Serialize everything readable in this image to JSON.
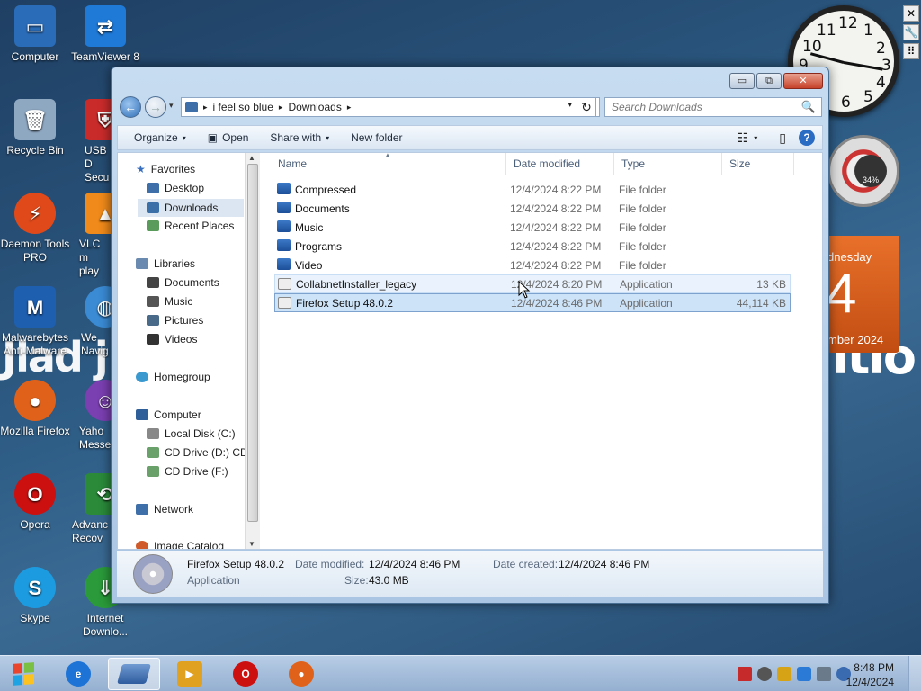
{
  "desktop": {
    "watermark_left": "Jlad j",
    "watermark_right": "itio",
    "icons": [
      {
        "label": "Computer",
        "color": "#2b6cb8"
      },
      {
        "label": "TeamViewer 8",
        "color": "#1f79d6"
      },
      {
        "label": "Recycle Bin",
        "color": "#8fa8c2"
      },
      {
        "label": "USB D Secu",
        "color": "#c92b2b"
      },
      {
        "label": "Daemon Tools PRO",
        "color": "#e04a1a"
      },
      {
        "label": "VLC m play",
        "color": "#f08a1a"
      },
      {
        "label": "Malwarebytes Anti-Malware",
        "color": "#1e5fb0"
      },
      {
        "label": "We Navig",
        "color": "#3a8bd4"
      },
      {
        "label": "Mozilla Firefox",
        "color": "#e0621a"
      },
      {
        "label": "Yaho Messe",
        "color": "#7a3fb0"
      },
      {
        "label": "Opera",
        "color": "#cc1010"
      },
      {
        "label": "Advanc Recov",
        "color": "#2a8a3a"
      },
      {
        "label": "Skype",
        "color": "#1d9be0"
      },
      {
        "label": "Internet Downlo...",
        "color": "#2a9a3a"
      }
    ],
    "clock_numbers": [
      "12",
      "1",
      "2",
      "3",
      "4",
      "5",
      "6",
      "7",
      "8",
      "9",
      "10",
      "11"
    ],
    "gauge_text": "34%",
    "calendar": {
      "day": "dnesday",
      "date": "4",
      "month": "mber 2024"
    },
    "side_buttons": [
      "✕",
      "🔧",
      "⠿"
    ]
  },
  "window": {
    "caption_buttons": {
      "minimize": "▭",
      "maximize": "⧉",
      "close": "✕"
    },
    "nav": {
      "back": "←",
      "forward": "→",
      "history": "▾"
    },
    "address": {
      "crumbs": [
        "i feel so blue",
        "Downloads"
      ],
      "separator": "▸",
      "dropdown": "▾",
      "refresh": "↻"
    },
    "search": {
      "placeholder": "Search Downloads",
      "icon": "🔍"
    },
    "commands": {
      "organize": "Organize",
      "open": "Open",
      "share": "Share with",
      "newfolder": "New folder",
      "arrow": "▾",
      "views_icon": "☷",
      "preview_icon": "▯",
      "help": "?"
    },
    "navpane": {
      "favorites": "Favorites",
      "desktop": "Desktop",
      "downloads": "Downloads",
      "recent": "Recent Places",
      "libraries": "Libraries",
      "documents": "Documents",
      "music": "Music",
      "pictures": "Pictures",
      "videos": "Videos",
      "homegroup": "Homegroup",
      "computer": "Computer",
      "localdisk": "Local Disk (C:)",
      "cddrive_d": "CD Drive (D:) CD",
      "cddrive_f": "CD Drive (F:)",
      "network": "Network",
      "imagecatalog": "Image Catalog"
    },
    "columns": {
      "name": "Name",
      "date": "Date modified",
      "type": "Type",
      "size": "Size",
      "sort_caret": "▲"
    },
    "files": [
      {
        "name": "Compressed",
        "date": "12/4/2024 8:22 PM",
        "type": "File folder",
        "size": ""
      },
      {
        "name": "Documents",
        "date": "12/4/2024 8:22 PM",
        "type": "File folder",
        "size": ""
      },
      {
        "name": "Music",
        "date": "12/4/2024 8:22 PM",
        "type": "File folder",
        "size": ""
      },
      {
        "name": "Programs",
        "date": "12/4/2024 8:22 PM",
        "type": "File folder",
        "size": ""
      },
      {
        "name": "Video",
        "date": "12/4/2024 8:22 PM",
        "type": "File folder",
        "size": ""
      },
      {
        "name": "CollabnetInstaller_legacy",
        "date": "12/4/2024 8:20 PM",
        "type": "Application",
        "size": "13 KB"
      },
      {
        "name": "Firefox Setup 48.0.2",
        "date": "12/4/2024 8:46 PM",
        "type": "Application",
        "size": "44,114 KB"
      }
    ],
    "details": {
      "name": "Firefox Setup 48.0.2",
      "type": "Application",
      "date_modified_label": "Date modified:",
      "date_modified": "12/4/2024 8:46 PM",
      "size_label": "Size:",
      "size": "43.0 MB",
      "date_created_label": "Date created:",
      "date_created": "12/4/2024 8:46 PM"
    }
  },
  "taskbar": {
    "time": "8:48 PM",
    "date": "12/4/2024",
    "buttons": [
      {
        "name": "internet-explorer",
        "glyph": "e",
        "color": "#1d73d6"
      },
      {
        "name": "explorer",
        "glyph": "",
        "color": "#3a70b8"
      },
      {
        "name": "media",
        "glyph": "▶",
        "color": "#e0a020"
      },
      {
        "name": "opera",
        "glyph": "O",
        "color": "#cc1010"
      },
      {
        "name": "firefox",
        "glyph": "●",
        "color": "#e0621a"
      }
    ]
  }
}
